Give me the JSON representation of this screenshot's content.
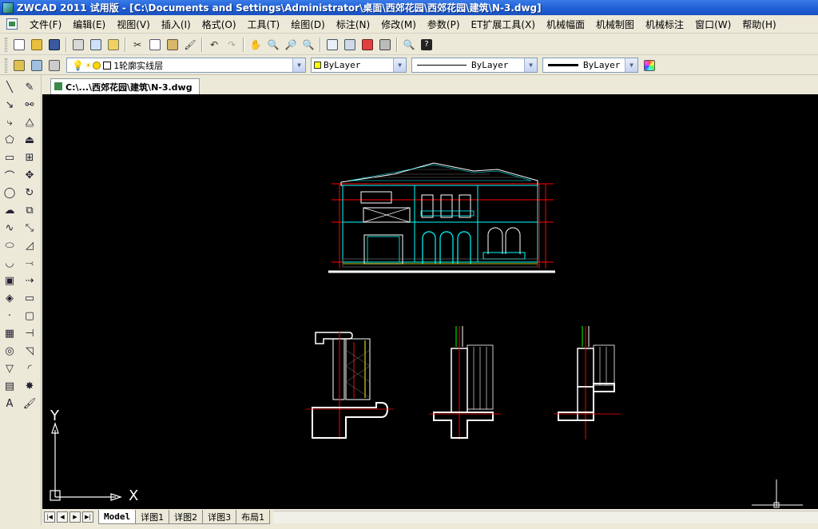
{
  "window": {
    "title": "ZWCAD 2011 试用版 - [C:\\Documents and Settings\\Administrator\\桌面\\西郊花园\\西郊花园\\建筑\\N-3.dwg]"
  },
  "menu": {
    "items": [
      {
        "label": "文件(F)"
      },
      {
        "label": "编辑(E)"
      },
      {
        "label": "视图(V)"
      },
      {
        "label": "插入(I)"
      },
      {
        "label": "格式(O)"
      },
      {
        "label": "工具(T)"
      },
      {
        "label": "绘图(D)"
      },
      {
        "label": "标注(N)"
      },
      {
        "label": "修改(M)"
      },
      {
        "label": "参数(P)"
      },
      {
        "label": "ET扩展工具(X)"
      },
      {
        "label": "机械幅面"
      },
      {
        "label": "机械制图"
      },
      {
        "label": "机械标注"
      },
      {
        "label": "窗口(W)"
      },
      {
        "label": "帮助(H)"
      }
    ]
  },
  "properties": {
    "layer": "1轮廓实线层",
    "color": "ByLayer",
    "color_swatch": "#ffff00",
    "linetype": "ByLayer",
    "lineweight": "ByLayer"
  },
  "document": {
    "tab_label": "C:\\...\\西郊花园\\建筑\\N-3.dwg"
  },
  "ucs": {
    "x_label": "X",
    "y_label": "Y"
  },
  "layout_tabs": [
    {
      "label": "Model",
      "active": true
    },
    {
      "label": "详图1",
      "active": false
    },
    {
      "label": "详图2",
      "active": false
    },
    {
      "label": "详图3",
      "active": false
    },
    {
      "label": "布局1",
      "active": false
    }
  ],
  "colors": {
    "canvas": "#000000",
    "cyan": "#00ffff",
    "red": "#ff0000",
    "white": "#ffffff",
    "yellow": "#ffff00",
    "green": "#00ff00",
    "titlebar": "#1f5fd6"
  },
  "icons": {
    "toolbar_standard": [
      "new-icon",
      "open-icon",
      "save-icon",
      "print-icon",
      "print-preview-icon",
      "publish-icon",
      "cut-icon",
      "copy-icon",
      "paste-icon",
      "match-properties-icon",
      "undo-icon",
      "redo-icon",
      "pan-icon",
      "zoom-realtime-icon",
      "zoom-window-icon",
      "zoom-previous-icon",
      "properties-icon",
      "design-center-icon",
      "tool-palettes-icon",
      "calculator-icon",
      "find-icon",
      "help-icon"
    ],
    "toolbar_layers": [
      "layer-manager-icon",
      "make-current-icon",
      "layer-previous-icon",
      "lightbulb-icon",
      "sun-icon",
      "lock-icon",
      "color-icon"
    ],
    "draw": [
      "line-icon",
      "construction-line-icon",
      "polyline-icon",
      "polygon-icon",
      "rectangle-icon",
      "arc-icon",
      "circle-icon",
      "revision-cloud-icon",
      "spline-icon",
      "ellipse-icon",
      "ellipse-arc-icon",
      "insert-block-icon",
      "make-block-icon",
      "point-icon",
      "hatch-icon",
      "region-icon",
      "table-icon",
      "text-icon"
    ],
    "modify": [
      "erase-icon",
      "copy-object-icon",
      "mirror-icon",
      "offset-icon",
      "array-icon",
      "move-icon",
      "rotate-icon",
      "scale-icon",
      "stretch-icon",
      "trim-icon",
      "extend-icon",
      "break-icon",
      "break-at-point-icon",
      "join-icon",
      "chamfer-icon",
      "fillet-icon",
      "explode-icon",
      "properties-paint-icon"
    ]
  }
}
